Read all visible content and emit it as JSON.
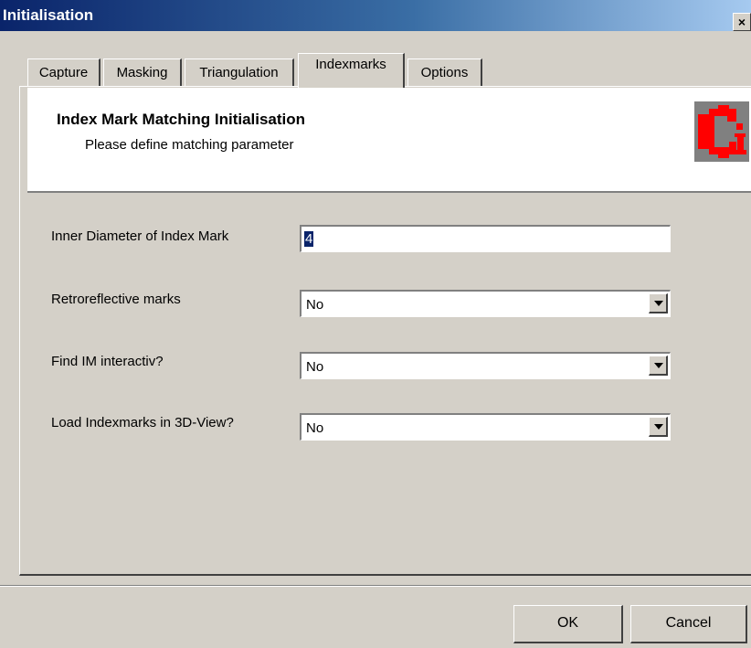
{
  "window": {
    "title": "Initialisation",
    "close_glyph": "×"
  },
  "tabs": [
    {
      "label": "Capture",
      "active": false
    },
    {
      "label": "Masking",
      "active": false
    },
    {
      "label": "Triangulation",
      "active": false
    },
    {
      "label": "Indexmarks",
      "active": true
    },
    {
      "label": "Options",
      "active": false
    }
  ],
  "header": {
    "title": "Index Mark Matching Initialisation",
    "subtitle": "Please define matching parameter",
    "logo_icon": "app-logo-icon",
    "logo_colors": {
      "red": "#ff0000",
      "gray": "#808080"
    }
  },
  "form": {
    "inner_diameter": {
      "label": "Inner Diameter of Index Mark",
      "value": "4"
    },
    "retroreflective": {
      "label": "Retroreflective marks",
      "value": "No"
    },
    "find_im": {
      "label": "Find IM interactiv?",
      "value": "No"
    },
    "load_indexmarks": {
      "label": "Load Indexmarks in 3D-View?",
      "value": "No"
    }
  },
  "buttons": {
    "ok": "OK",
    "cancel": "Cancel"
  }
}
